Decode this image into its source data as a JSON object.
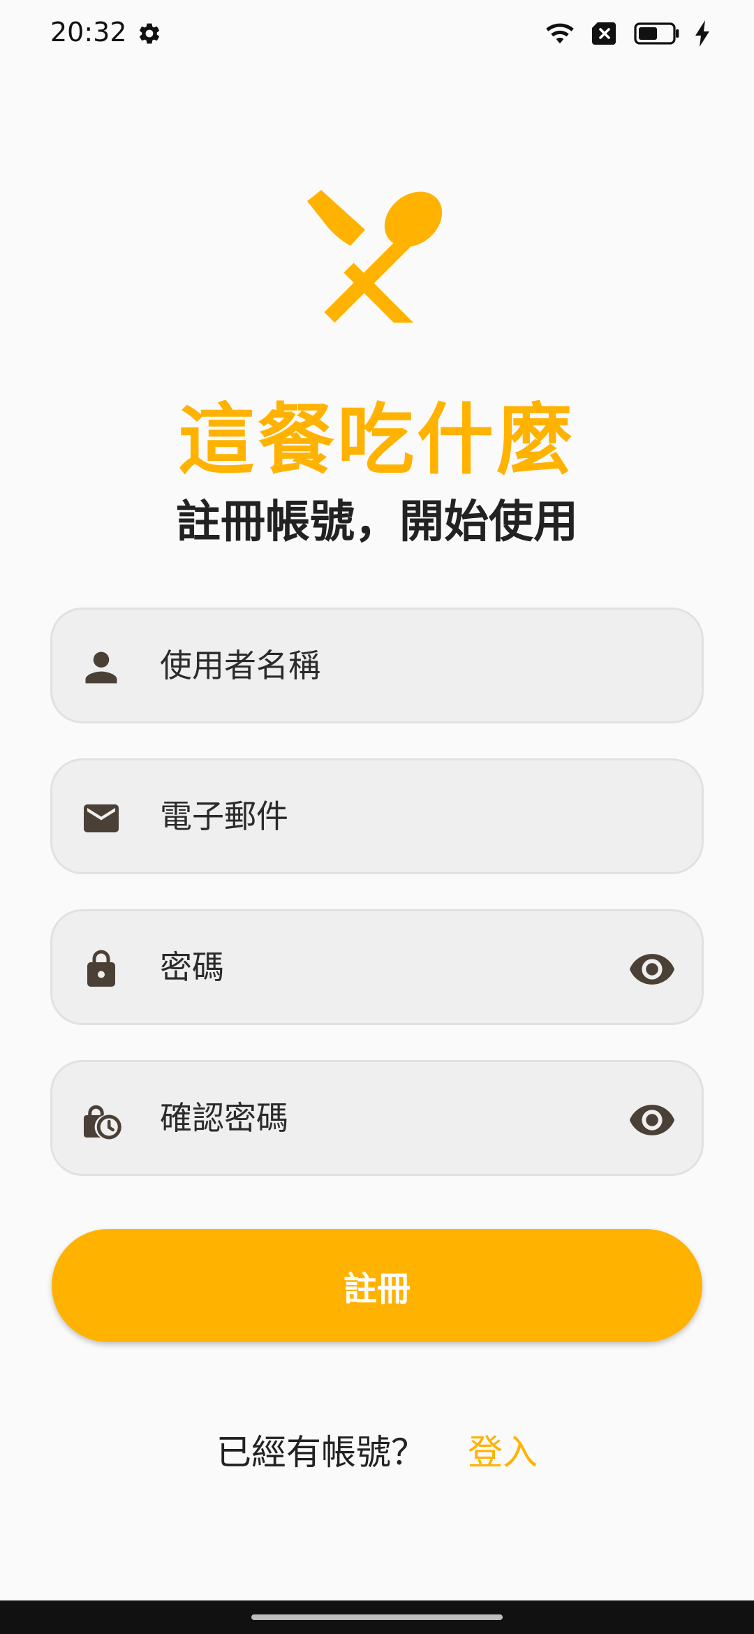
{
  "status_bar": {
    "time": "20:32"
  },
  "app": {
    "title": "這餐吃什麼",
    "subtitle": "註冊帳號，開始使用"
  },
  "form": {
    "username_placeholder": "使用者名稱",
    "email_placeholder": "電子郵件",
    "password_placeholder": "密碼",
    "confirm_password_placeholder": "確認密碼",
    "submit_label": "註冊"
  },
  "footer": {
    "prompt": "已經有帳號？",
    "login_label": "登入"
  },
  "icons": {
    "hero": "fork-spoon-icon",
    "username": "person-icon",
    "email": "mail-icon",
    "password": "lock-icon",
    "confirm_password": "lock-clock-icon",
    "toggle_visibility": "eye-icon"
  },
  "colors": {
    "accent": "#FFB300",
    "field_bg": "#EFEFEF",
    "icon": "#4A4036",
    "background": "#FAFAFA"
  }
}
